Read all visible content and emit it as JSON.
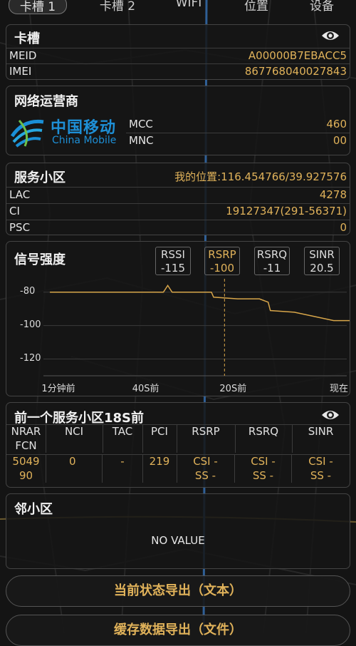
{
  "tabs": [
    {
      "label": "卡槽 1",
      "active": true
    },
    {
      "label": "卡槽 2",
      "active": false
    },
    {
      "label": "WIFI",
      "active": false
    },
    {
      "label": "位置",
      "active": false
    },
    {
      "label": "设备",
      "active": false
    }
  ],
  "sim_card": {
    "title": "卡槽",
    "meid_label": "MEID",
    "meid_value": "A00000B7EBACC5",
    "imei_label": "IMEI",
    "imei_value": "867768040027843"
  },
  "operator": {
    "title": "网络运营商",
    "logo_cn": "中国移动",
    "logo_en": "China Mobile",
    "mcc_label": "MCC",
    "mcc_value": "460",
    "mnc_label": "MNC",
    "mnc_value": "00"
  },
  "serving_cell": {
    "title": "服务小区",
    "location": "我的位置:116.454766/39.927576",
    "lac_label": "LAC",
    "lac_value": "4278",
    "ci_label": "CI",
    "ci_value": "19127347(291-56371)",
    "psc_label": "PSC",
    "psc_value": "0"
  },
  "signal": {
    "title": "信号强度",
    "metrics": [
      {
        "label": "RSSI",
        "value": "-115",
        "selected": false
      },
      {
        "label": "RSRP",
        "value": "-100",
        "selected": true
      },
      {
        "label": "RSRQ",
        "value": "-11",
        "selected": false
      },
      {
        "label": "SINR",
        "value": "20.5",
        "selected": false
      }
    ]
  },
  "chart_data": {
    "type": "line",
    "title": "信号强度",
    "series": [
      {
        "name": "RSRP",
        "x": [
          0,
          8,
          26,
          27,
          28,
          30,
          37,
          37.5,
          43,
          48,
          50,
          50.5,
          56,
          65,
          75,
          78,
          80
        ],
        "y": [
          -80,
          -80,
          -80,
          -76,
          -80,
          -80,
          -80,
          -83,
          -84,
          -84,
          -86,
          -91,
          -92,
          -97,
          -97,
          -100,
          -100
        ]
      }
    ],
    "ytick_labels": [
      "-80",
      "-100",
      "-120"
    ],
    "yticks": [
      -80,
      -100,
      -120
    ],
    "ylim": [
      -130,
      -72
    ],
    "xtick_labels": [
      "1分钟前",
      "40S前",
      "20S前",
      "现在"
    ],
    "xticks": [
      0,
      20,
      40,
      60
    ],
    "xlim": [
      -8,
      68
    ],
    "marker_x": 40,
    "color": "#d8a64a",
    "grid": true
  },
  "previous_cell": {
    "title": "前一个服务小区18S前",
    "headers": [
      "NRAR FCN",
      "NCI",
      "TAC",
      "PCI",
      "RSRP",
      "RSRQ",
      "SINR"
    ],
    "values": [
      "5049 90",
      "0",
      "-",
      "219",
      "CSI - SS -",
      "CSI - SS -",
      "CSI - SS -"
    ]
  },
  "neighbor_cell": {
    "title": "邻小区",
    "empty_text": "NO VALUE"
  },
  "buttons": {
    "export_text": "当前状态导出（文本）",
    "export_file": "缓存数据导出（文件）"
  }
}
